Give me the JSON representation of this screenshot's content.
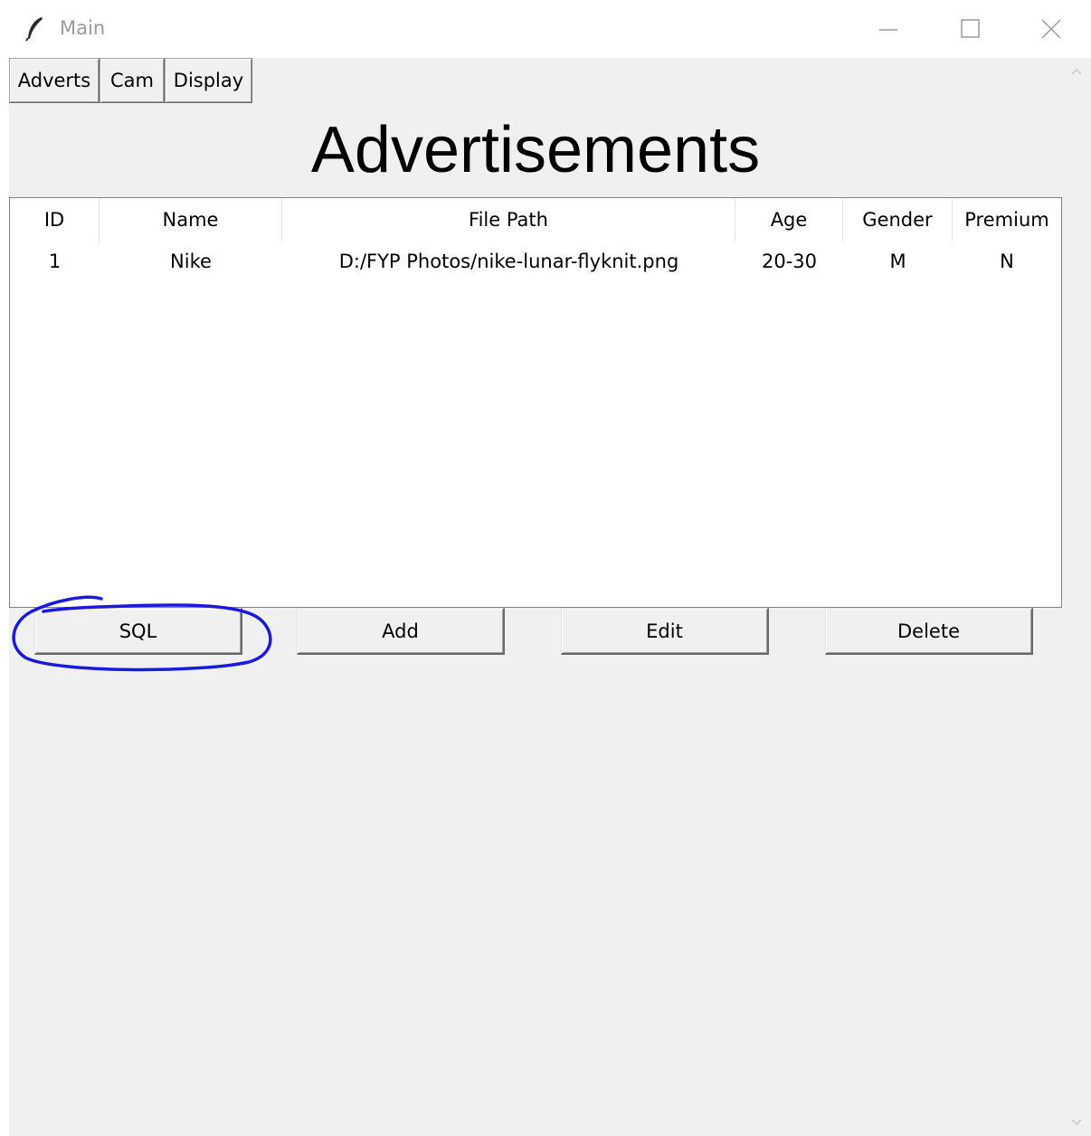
{
  "window": {
    "title": "Main",
    "icon": "feather-icon",
    "controls": [
      "minimize-icon",
      "maximize-icon",
      "close-icon"
    ]
  },
  "nav": {
    "adverts": "Adverts",
    "cam": "Cam",
    "display": "Display"
  },
  "page": {
    "title": "Advertisements"
  },
  "table": {
    "columns": [
      "ID",
      "Name",
      "File Path",
      "Age",
      "Gender",
      "Premium"
    ],
    "rows": [
      [
        "1",
        "Nike",
        "D:/FYP Photos/nike-lunar-flyknit.png",
        "20-30",
        "M",
        "N"
      ]
    ]
  },
  "actions": {
    "sql": "SQL",
    "add": "Add",
    "edit": "Edit",
    "delete": "Delete"
  },
  "annotation": {
    "color": "#1a1adc",
    "shape": "hand-drawn ellipse around SQL button"
  },
  "colors": {
    "background": "#f0f0f0",
    "table_bg": "#ffffff",
    "title_text": "#9a9a9a"
  }
}
